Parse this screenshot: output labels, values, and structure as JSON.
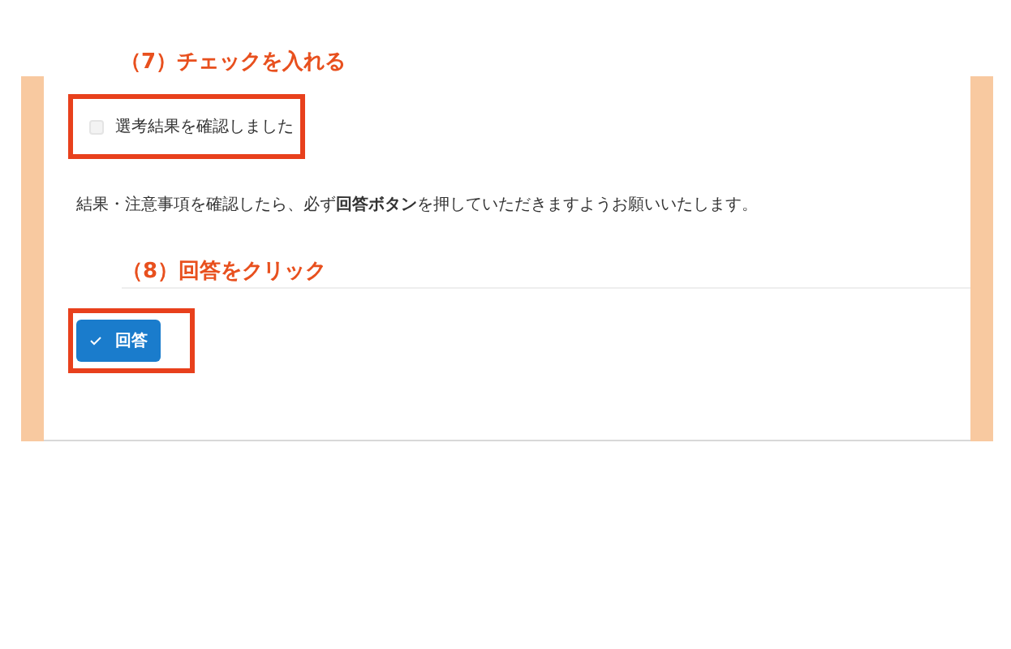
{
  "annotations": [
    "（7）チェックを入れる",
    "（8）回答をクリック"
  ],
  "checkbox": {
    "label": "選考結果を確認しました",
    "checked": false
  },
  "instruction": "結果・注意事項を確認したら、必ず**回答ボタン**を押していただきますようお願いいたします。",
  "answer_button": {
    "label": "回答"
  }
}
